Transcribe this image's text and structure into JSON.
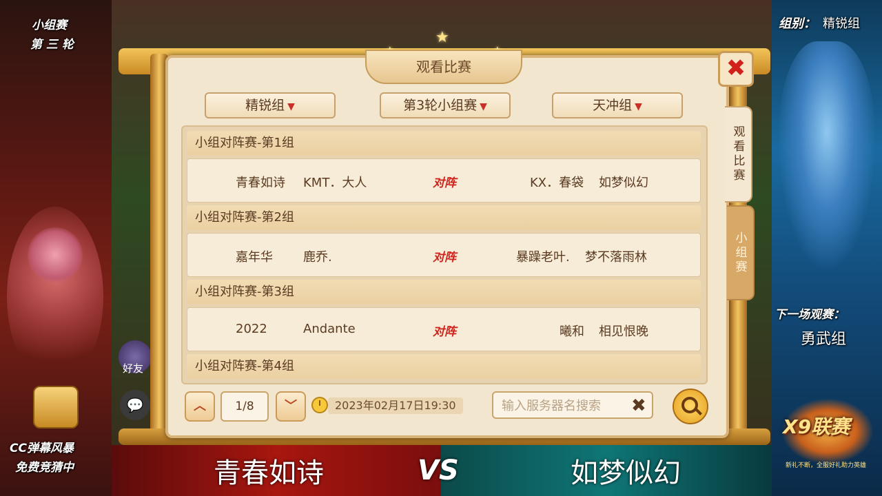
{
  "left_overlay": {
    "stage": "小组赛",
    "round": "第 三 轮",
    "cc_line1": "CC弹幕风暴",
    "cc_line2": "免费竞猜中"
  },
  "right_overlay": {
    "group_label": "组别：",
    "group_value": "精锐组",
    "next_label": "下一场观赛：",
    "next_value": "勇武组",
    "logo_text": "X9联赛",
    "logo_sub": "新礼不断，全服好礼助力英雄"
  },
  "game_ui": {
    "friend_label": "好友",
    "chat_icon": "speech-bubble-icon"
  },
  "window": {
    "title": "观看比赛",
    "close_icon": "close-x-icon",
    "tabs": [
      {
        "label": "观看比赛",
        "active": true
      },
      {
        "label": "小组赛",
        "active": false
      }
    ],
    "filters": [
      {
        "label": "精锐组",
        "chevron": "▼"
      },
      {
        "label": "第3轮小组赛",
        "chevron": "▼"
      },
      {
        "label": "天冲组",
        "chevron": "▼"
      }
    ],
    "groups": [
      {
        "header": "小组对阵赛-第1组",
        "team_a_server": "青春如诗",
        "team_a_player": "KMT．大人",
        "vs": "对阵",
        "team_b_player": "KX．春袋",
        "team_b_server": "如梦似幻"
      },
      {
        "header": "小组对阵赛-第2组",
        "team_a_server": "嘉年华",
        "team_a_player": "鹿乔.",
        "vs": "对阵",
        "team_b_player": "暴躁老叶.",
        "team_b_server": "梦不落雨林"
      },
      {
        "header": "小组对阵赛-第3组",
        "team_a_server": "2022",
        "team_a_player": "Andante",
        "vs": "对阵",
        "team_b_player": "曦和",
        "team_b_server": "相见恨晚"
      },
      {
        "header": "小组对阵赛-第4组"
      }
    ],
    "pagination": {
      "page": "1/8",
      "up": "︿",
      "down": "﹀"
    },
    "datetime": "2023年02月17日19:30",
    "search": {
      "placeholder": "输入服务器名搜索",
      "clear": "✖"
    }
  },
  "vs_bar": {
    "team_left": "青春如诗",
    "vs": "VS",
    "team_right": "如梦似幻",
    "colors": {
      "left": "#a8160f",
      "right": "#0f7676"
    }
  }
}
